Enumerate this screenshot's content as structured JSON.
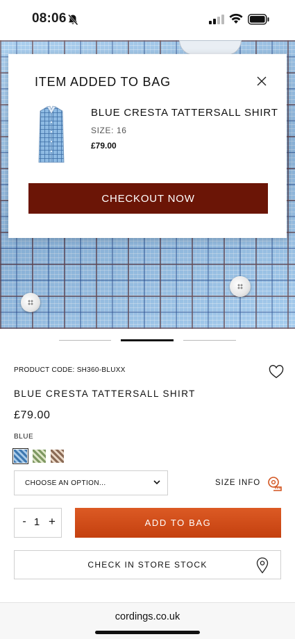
{
  "status_bar": {
    "time": "08:06",
    "icons": [
      "bell-slash-icon",
      "signal-icon",
      "wifi-icon",
      "battery-icon"
    ]
  },
  "modal": {
    "title": "ITEM ADDED TO BAG",
    "close_icon": "close-icon",
    "product_name": "BLUE CRESTA TATTERSALL SHIRT",
    "size": "SIZE: 16",
    "price": "£79.00",
    "checkout_label": "CHECKOUT NOW"
  },
  "carousel": {
    "slides": 3,
    "active_index": 1
  },
  "product": {
    "code": "PRODUCT CODE: SH360-BLUXX",
    "title": "BLUE CRESTA TATTERSALL SHIRT",
    "price": "£79.00",
    "colour": "BLUE",
    "swatches": [
      "blue",
      "green",
      "brown"
    ]
  },
  "size_select": {
    "placeholder": "CHOOSE AN OPTION...",
    "size_info_label": "SIZE INFO"
  },
  "quantity": {
    "minus": "-",
    "value": "1",
    "plus": "+"
  },
  "buttons": {
    "add_to_bag": "ADD TO BAG",
    "store_stock": "CHECK IN STORE STOCK"
  },
  "browser": {
    "url": "cordings.co.uk"
  },
  "colors": {
    "checkout_bg": "#6b1506",
    "add_to_bag_bg": "#d04d1a",
    "shirt_blue": "#9cc7ec"
  }
}
